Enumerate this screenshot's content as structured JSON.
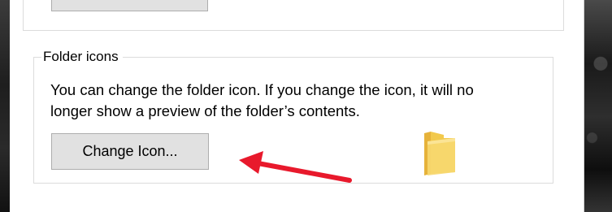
{
  "group": {
    "title": "Folder icons",
    "description": "You can change the folder icon. If you change the icon, it will no longer show a preview of the folder’s contents.",
    "change_icon_button": "Change Icon..."
  },
  "colors": {
    "annotation_arrow": "#e8192c",
    "folder_icon": "#f2c94c",
    "button_face": "#e1e1e1",
    "button_border": "#adadad"
  },
  "icons": {
    "folder": "folder-icon",
    "annotation": "red-arrow-icon"
  }
}
